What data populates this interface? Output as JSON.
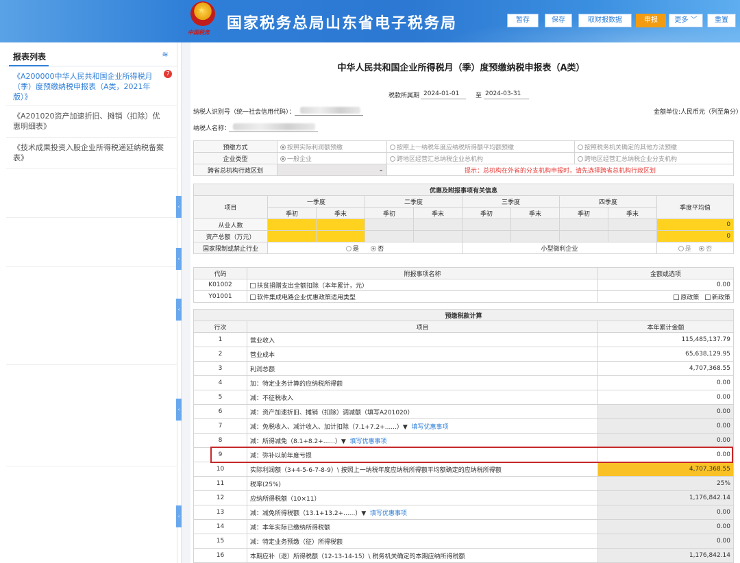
{
  "header": {
    "title": "国家税务总局山东省电子税务局",
    "emblem_sub": "中国税务",
    "buttons": {
      "hold": "暂存",
      "save": "保存",
      "fetch": "取财报数据",
      "declare": "申报",
      "more": "更多",
      "reset": "重置"
    }
  },
  "sidebar": {
    "title": "报表列表",
    "badge": "7",
    "items": [
      {
        "label": "《A200000中华人民共和国企业所得税月（季）度预缴纳税申报表（A类，2021年版）》"
      },
      {
        "label": "《A201020资产加速折旧、摊销（扣除）优惠明细表》"
      },
      {
        "label": "《技术成果投资入股企业所得税递延纳税备案表》"
      }
    ]
  },
  "form": {
    "title": "中华人民共和国企业所得税月（季）度预缴纳税申报表（A类）",
    "period_label": "税款所属期",
    "period_start": "2024-01-01",
    "period_to": "至",
    "period_end": "2024-03-31",
    "taxpayer_id_label": "纳税人识别号（统一社会信用代码）：",
    "taxpayer_name_label": "纳税人名称：",
    "unit_label": "金额单位:人民币元（列至角分）"
  },
  "basic": {
    "method_label": "预缴方式",
    "method_options": [
      "按照实际利润额预缴",
      "按照上一纳税年度应纳税所得额平均额预缴",
      "按照税务机关确定的其他方法预缴"
    ],
    "type_label": "企业类型",
    "type_options": [
      "一般企业",
      "跨地区经营汇总纳税企业总机构",
      "跨地区经营汇总纳税企业分支机构"
    ],
    "region_label": "跨省总机构行政区划",
    "region_hint": "提示：总机构在外省的分支机构申报时，请先选择跨省总机构行政区划"
  },
  "pref": {
    "section_title": "优惠及附报事项有关信息",
    "col_item": "项目",
    "quarters": [
      "一季度",
      "二季度",
      "三季度",
      "四季度"
    ],
    "q_start": "季初",
    "q_end": "季末",
    "avg_label": "季度平均值",
    "employees_label": "从业人数",
    "employees_avg": "0",
    "assets_label": "资产总额（万元）",
    "assets_avg": "0",
    "restricted_label": "国家限制或禁止行业",
    "restricted_yes": "是",
    "restricted_no": "否",
    "small_label": "小型微利企业",
    "small_yes": "是",
    "small_no": "否"
  },
  "attach": {
    "col_code": "代码",
    "col_name": "附报事项名称",
    "col_amount": "金额或选项",
    "rows": [
      {
        "code": "K01002",
        "name": "扶贫捐赠支出全额扣除（本年累计，元）",
        "value": "0.00"
      },
      {
        "code": "Y01001",
        "name": "软件集成电路企业优惠政策适用类型",
        "opt1": "原政策",
        "opt2": "新政策"
      }
    ]
  },
  "calc": {
    "section_title": "预缴税款计算",
    "col_line": "行次",
    "col_item": "项目",
    "col_amount": "本年累计金额",
    "fill_pref": "填写优惠事项",
    "rows": [
      {
        "line": "1",
        "item": "营业收入",
        "amount": "115,485,137.79"
      },
      {
        "line": "2",
        "item": "营业成本",
        "amount": "65,638,129.95"
      },
      {
        "line": "3",
        "item": "利润总额",
        "amount": "4,707,368.55"
      },
      {
        "line": "4",
        "item": "加：特定业务计算的应纳税所得额",
        "amount": "0.00"
      },
      {
        "line": "5",
        "item": "减：不征税收入",
        "amount": "0.00"
      },
      {
        "line": "6",
        "item": "减：资产加速折旧、摊销（扣除）调减额（填写A201020）",
        "amount": "0.00"
      },
      {
        "line": "7",
        "item": "减：免税收入、减计收入、加计扣除（7.1+7.2+......）▼",
        "amount": "0.00"
      },
      {
        "line": "8",
        "item": "减：所得减免（8.1+8.2+......）▼",
        "amount": "0.00"
      },
      {
        "line": "9",
        "item": "减：弥补以前年度亏损",
        "amount": "0.00"
      },
      {
        "line": "10",
        "item": "实际利润额（3+4-5-6-7-8-9）\\ 按照上一纳税年度应纳税所得额平均额确定的应纳税所得额",
        "amount": "4,707,368.55"
      },
      {
        "line": "11",
        "item": "税率(25%)",
        "amount": "25%"
      },
      {
        "line": "12",
        "item": "应纳所得税额（10×11）",
        "amount": "1,176,842.14"
      },
      {
        "line": "13",
        "item": "减：减免所得税额（13.1+13.2+......）▼",
        "amount": "0.00"
      },
      {
        "line": "14",
        "item": "减：本年实际已缴纳所得税额",
        "amount": "0.00"
      },
      {
        "line": "15",
        "item": "减：特定业务预缴（征）所得税额",
        "amount": "0.00"
      },
      {
        "line": "16",
        "item": "本期应补（退）所得税额（12-13-14-15）\\ 税务机关确定的本期应纳所得税额",
        "amount": "1,176,842.14"
      }
    ]
  }
}
